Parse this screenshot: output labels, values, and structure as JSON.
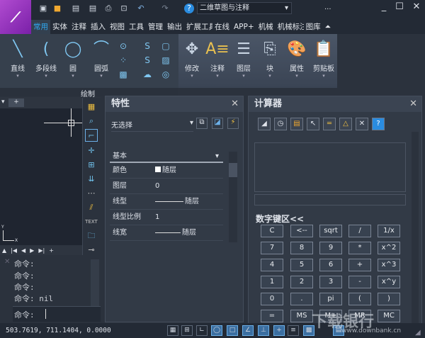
{
  "titlebar": {
    "workspace": "二维草图与注释",
    "more": "...",
    "logo_letter": "M",
    "quick_access": [
      "new-icon",
      "open-icon",
      "save-icon",
      "save-as-icon",
      "print-icon",
      "plot-preview-icon",
      "undo-icon",
      "redo-icon",
      "help-icon"
    ]
  },
  "tabs": [
    "常用",
    "实体",
    "注释",
    "插入",
    "视图",
    "工具",
    "管理",
    "输出",
    "扩展工具",
    "在线",
    "APP+",
    "机械",
    "机械标注",
    "图库"
  ],
  "ribbon": {
    "draw": [
      "直线",
      "多段线",
      "圆",
      "圆弧"
    ],
    "draw_panel": "绘制",
    "groups": [
      "修改",
      "注释",
      "图层",
      "块",
      "属性",
      "剪贴板"
    ]
  },
  "properties": {
    "title": "特性",
    "selection": "无选择",
    "section": "基本",
    "rows": [
      {
        "key": "颜色",
        "value": "随层"
      },
      {
        "key": "图层",
        "value": "0"
      },
      {
        "key": "线型",
        "value": "随层"
      },
      {
        "key": "线型比例",
        "value": "1"
      },
      {
        "key": "线宽",
        "value": "随层"
      }
    ]
  },
  "calculator": {
    "title": "计算器",
    "keypad_label": "数字键区<<",
    "buttons": [
      [
        "C",
        "<--",
        "sqrt",
        "/",
        "1/x"
      ],
      [
        "7",
        "8",
        "9",
        "*",
        "x^2"
      ],
      [
        "4",
        "5",
        "6",
        "+",
        "x^3"
      ],
      [
        "1",
        "2",
        "3",
        "-",
        "x^y"
      ],
      [
        "0",
        ".",
        "pi",
        "(",
        ")"
      ],
      [
        "=",
        "MS",
        "M+",
        "MR",
        "MC"
      ]
    ]
  },
  "command": {
    "lines": [
      "命令:",
      "命令:",
      "命令:",
      "命令: nil"
    ],
    "prompt": "命令:"
  },
  "axis": {
    "x": "X",
    "y": "Y"
  },
  "status": {
    "coords": "503.7619, 711.1404, 0.0000"
  },
  "watermark": {
    "text": "下载银行",
    "url": "www.downbank.cn"
  }
}
